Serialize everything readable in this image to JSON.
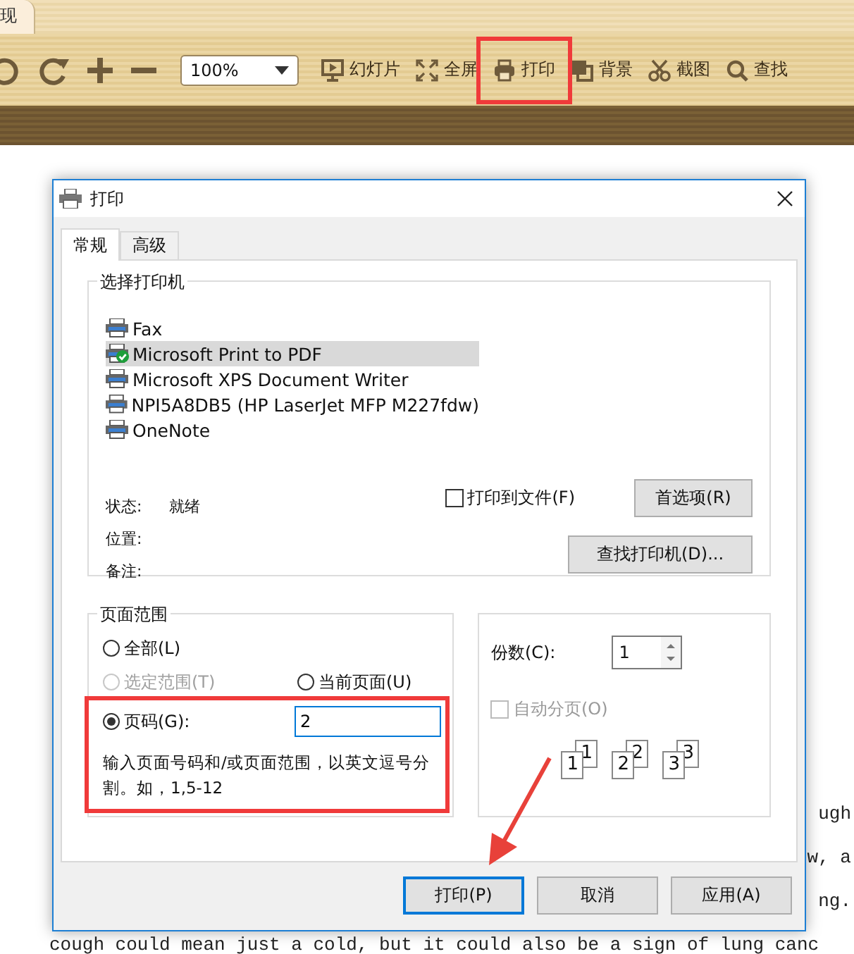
{
  "app_tab": {
    "label": "现"
  },
  "toolbar": {
    "zoom": "100%",
    "items": [
      {
        "kind": "undo",
        "highlighted": false
      },
      {
        "kind": "redo",
        "highlighted": false
      },
      {
        "kind": "zoom_in",
        "highlighted": false
      },
      {
        "kind": "zoom_out",
        "highlighted": false
      },
      {
        "kind": "slideshow",
        "label": "幻灯片",
        "highlighted": false
      },
      {
        "kind": "fullscreen",
        "label": "全屏",
        "highlighted": false
      },
      {
        "kind": "print",
        "label": "打印",
        "highlighted": true
      },
      {
        "kind": "background",
        "label": "背景",
        "highlighted": false
      },
      {
        "kind": "screenshot",
        "label": "截图",
        "highlighted": false
      },
      {
        "kind": "search",
        "label": "查找",
        "highlighted": false
      }
    ]
  },
  "document": {
    "lines": [
      "ugh",
      "w, a",
      "ng.",
      "cough could mean just a cold, but it could also be a sign of lung canc"
    ]
  },
  "dialog": {
    "title": "打印",
    "tabs": [
      {
        "label": "常规",
        "selected": true
      },
      {
        "label": "高级",
        "selected": false
      }
    ],
    "printer_group": {
      "title": "选择打印机",
      "printers": [
        {
          "name": "Fax",
          "selected": false,
          "default": false
        },
        {
          "name": "Microsoft Print to PDF",
          "selected": true,
          "default": true
        },
        {
          "name": "Microsoft XPS Document Writer",
          "selected": false,
          "default": false
        },
        {
          "name": "NPI5A8DB5 (HP LaserJet MFP M227fdw)",
          "selected": false,
          "default": false
        },
        {
          "name": "OneNote",
          "selected": false,
          "default": false
        }
      ],
      "info": [
        {
          "label": "状态:",
          "value": "就绪"
        },
        {
          "label": "位置:"
        },
        {
          "label": "备注:"
        }
      ],
      "print_to_file": {
        "label": "打印到文件(F)",
        "checked": false
      },
      "preferences_button": "首选项(R)",
      "find_printer_button": "查找打印机(D)..."
    },
    "page_range": {
      "title": "页面范围",
      "highlighted": true,
      "options": [
        {
          "label": "全部(L)",
          "selected": false,
          "disabled": false
        },
        {
          "label": "选定范围(T)",
          "selected": false,
          "disabled": true
        },
        {
          "label": "当前页面(U)",
          "selected": false,
          "disabled": false
        },
        {
          "label": "页码(G):",
          "selected": true,
          "disabled": false
        }
      ],
      "pages_value": "2",
      "hint": "输入页面号码和/或页面范围，以英文逗号分割。如，1,5-12"
    },
    "copies": {
      "label": "份数(C):",
      "value": "1",
      "collate": {
        "label": "自动分页(O)",
        "checked": false,
        "disabled": true
      },
      "collate_pages": [
        "1",
        "1",
        "2",
        "2",
        "3",
        "3"
      ]
    },
    "buttons": [
      {
        "label": "打印(P)",
        "focused": true,
        "arrow": true
      },
      {
        "label": "取消",
        "focused": false,
        "arrow": false
      },
      {
        "label": "应用(A)",
        "focused": false,
        "arrow": false
      }
    ]
  }
}
